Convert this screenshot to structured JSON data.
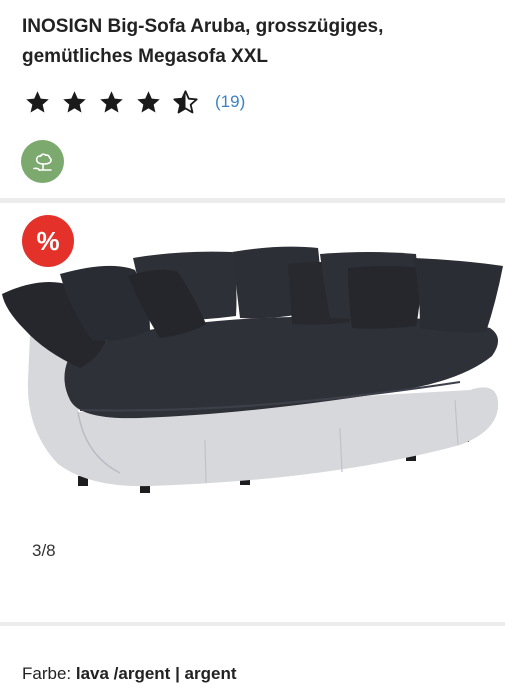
{
  "product": {
    "title": "INOSIGN Big-Sofa Aruba, grosszügiges, gemütliches Megasofa XXL",
    "rating": 4.5,
    "rating_count": "(19)"
  },
  "badges": {
    "eco_icon": "tree-leaf-icon",
    "sale_text": "%"
  },
  "gallery": {
    "counter": "3/8"
  },
  "variant": {
    "label": "Farbe: ",
    "value": "lava /argent | argent"
  },
  "colors": {
    "rating_link": "#3b82c4",
    "eco_green": "#7ba96e",
    "sale_red": "#e4322b",
    "sofa_fabric": "#2c2e36",
    "sofa_base": "#d6d8dc"
  }
}
